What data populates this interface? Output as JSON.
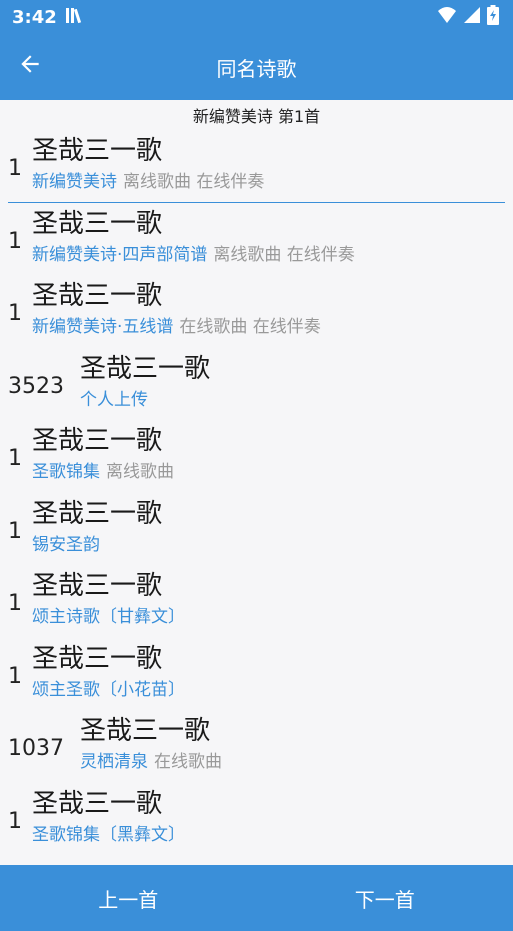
{
  "status": {
    "time": "3:42"
  },
  "appbar": {
    "title": "同名诗歌"
  },
  "header": {
    "text": "新编赞美诗  第1首"
  },
  "list": [
    {
      "number": "1",
      "title": "圣哉三一歌",
      "source": "新编赞美诗",
      "tags": "离线歌曲 在线伴奏",
      "selected": true
    },
    {
      "number": "1",
      "title": "圣哉三一歌",
      "source": "新编赞美诗·四声部简谱",
      "tags": "离线歌曲 在线伴奏"
    },
    {
      "number": "1",
      "title": "圣哉三一歌",
      "source": "新编赞美诗·五线谱",
      "tags": "在线歌曲 在线伴奏"
    },
    {
      "number": "3523",
      "title": "圣哉三一歌",
      "source": "个人上传",
      "tags": ""
    },
    {
      "number": "1",
      "title": "圣哉三一歌",
      "source": "圣歌锦集",
      "tags": "离线歌曲"
    },
    {
      "number": "1",
      "title": "圣哉三一歌",
      "source": "锡安圣韵",
      "tags": ""
    },
    {
      "number": "1",
      "title": "圣哉三一歌",
      "source": "颂主诗歌〔甘彝文〕",
      "tags": ""
    },
    {
      "number": "1",
      "title": "圣哉三一歌",
      "source": "颂主圣歌〔小花苗〕",
      "tags": ""
    },
    {
      "number": "1037",
      "title": "圣哉三一歌",
      "source": "灵栖清泉",
      "tags": "在线歌曲"
    },
    {
      "number": "1",
      "title": "圣哉三一歌",
      "source": "圣歌锦集〔黑彝文〕",
      "tags": ""
    }
  ],
  "bottom": {
    "prev_label": "上一首",
    "next_label": "下一首"
  },
  "colors": {
    "primary": "#3a8fd9",
    "source_text": "#3a8fd9",
    "tag_text": "#999999"
  }
}
